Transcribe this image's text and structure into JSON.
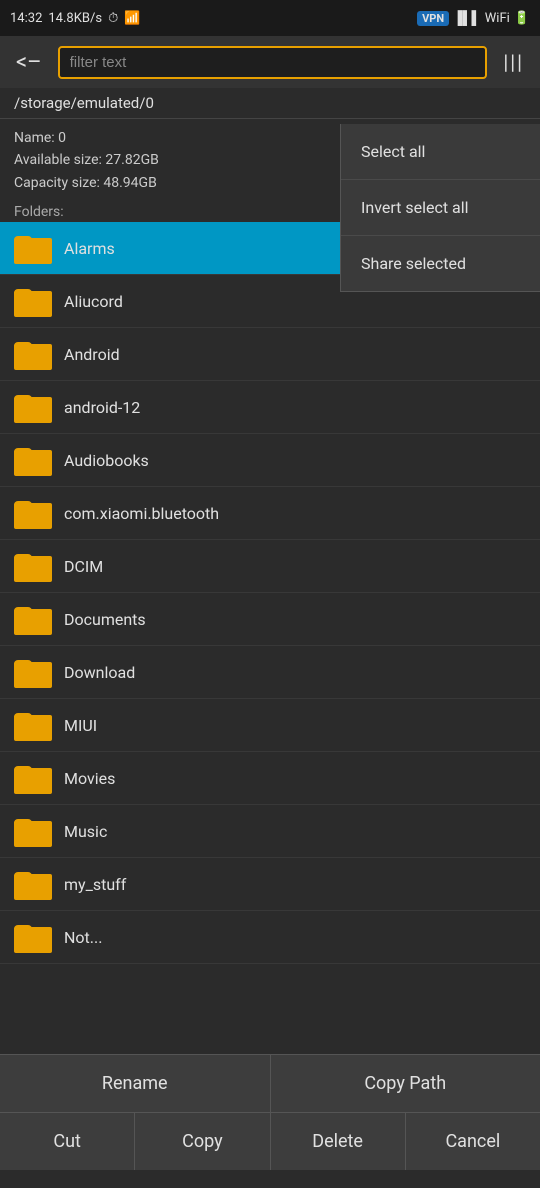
{
  "status_bar": {
    "time": "14:32",
    "data_speed": "14.8KB/s",
    "vpn_label": "VPN"
  },
  "top_bar": {
    "back_label": "<-",
    "filter_placeholder": "filter text",
    "menu_icon": "|||"
  },
  "path": "/storage/emulated/0",
  "info": {
    "name_label": "Name: 0",
    "available_label": "Available size: 27.82GB",
    "capacity_label": "Capacity size: 48.94GB"
  },
  "folders_label": "Folders:",
  "context_menu": {
    "select_all": "Select all",
    "invert_select_all": "Invert select all",
    "share_selected": "Share selected"
  },
  "folders": [
    {
      "name": "Alarms",
      "selected": true
    },
    {
      "name": "Aliucord",
      "selected": false
    },
    {
      "name": "Android",
      "selected": false
    },
    {
      "name": "android-12",
      "selected": false
    },
    {
      "name": "Audiobooks",
      "selected": false
    },
    {
      "name": "com.xiaomi.bluetooth",
      "selected": false
    },
    {
      "name": "DCIM",
      "selected": false
    },
    {
      "name": "Documents",
      "selected": false
    },
    {
      "name": "Download",
      "selected": false
    },
    {
      "name": "MIUI",
      "selected": false
    },
    {
      "name": "Movies",
      "selected": false
    },
    {
      "name": "Music",
      "selected": false
    },
    {
      "name": "my_stuff",
      "selected": false
    },
    {
      "name": "Not...",
      "selected": false
    }
  ],
  "action_bar_top": {
    "rename_label": "Rename",
    "copy_path_label": "Copy Path"
  },
  "action_bar_bottom": {
    "cut_label": "Cut",
    "copy_label": "Copy",
    "delete_label": "Delete",
    "cancel_label": "Cancel"
  }
}
